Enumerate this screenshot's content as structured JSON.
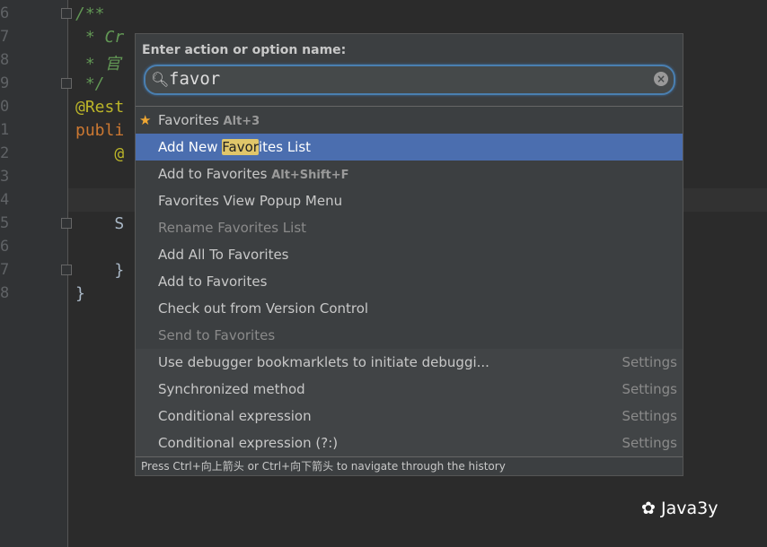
{
  "editor": {
    "line_numbers": [
      "6",
      "7",
      "8",
      "9",
      "0",
      "1",
      "2",
      "3",
      "4",
      "5",
      "6",
      "7",
      "8"
    ],
    "lines": [
      {
        "text": "/**",
        "color": "#629755"
      },
      {
        "text": " * Cr",
        "color": "#629755"
      },
      {
        "text": " * 官",
        "color": "#629755"
      },
      {
        "text": " */",
        "color": "#629755"
      },
      {
        "text": "@Rest",
        "color": "#bbb529"
      },
      {
        "text": "publi",
        "color": "#cc7832"
      },
      {
        "text": "    @",
        "color": "#bbb529"
      },
      {
        "text": "",
        "color": "#a9b7c6"
      },
      {
        "text": "",
        "color": "#a9b7c6"
      },
      {
        "text": "    S",
        "color": "#a9b7c6"
      },
      {
        "text": "",
        "color": "#a9b7c6"
      },
      {
        "text": "    }",
        "color": "#a9b7c6"
      },
      {
        "text": "}",
        "color": "#a9b7c6"
      }
    ]
  },
  "popup": {
    "title": "Enter action or option name:",
    "search_value": "favor",
    "header": {
      "label": "Favorites",
      "shortcut": "Alt+3"
    },
    "selected": {
      "pre": "Add New ",
      "match": "Favor",
      "post": "ites List"
    },
    "items": [
      {
        "label": "Add to Favorites",
        "shortcut": "Alt+Shift+F",
        "state": "normal",
        "right": ""
      },
      {
        "label": "Favorites View Popup Menu",
        "shortcut": "",
        "state": "normal",
        "right": ""
      },
      {
        "label": "Rename Favorites List",
        "shortcut": "",
        "state": "disabled",
        "right": ""
      },
      {
        "label": "Add All To Favorites",
        "shortcut": "",
        "state": "normal",
        "right": ""
      },
      {
        "label": "Add to Favorites",
        "shortcut": "",
        "state": "normal",
        "right": ""
      },
      {
        "label": "Check out from Version Control",
        "shortcut": "",
        "state": "normal",
        "right": ""
      },
      {
        "label": "Send to Favorites",
        "shortcut": "",
        "state": "disabled",
        "right": ""
      },
      {
        "label": "Use debugger bookmarklets to initiate debuggi...",
        "shortcut": "",
        "state": "option",
        "right": "Settings"
      },
      {
        "label": "Synchronized method",
        "shortcut": "",
        "state": "option",
        "right": "Settings"
      },
      {
        "label": "Conditional expression",
        "shortcut": "",
        "state": "option",
        "right": "Settings"
      },
      {
        "label": "Conditional expression (?:)",
        "shortcut": "",
        "state": "option",
        "right": "Settings"
      }
    ],
    "footer": "Press Ctrl+向上箭头 or Ctrl+向下箭头 to navigate through the history"
  },
  "watermark": "Java3y"
}
